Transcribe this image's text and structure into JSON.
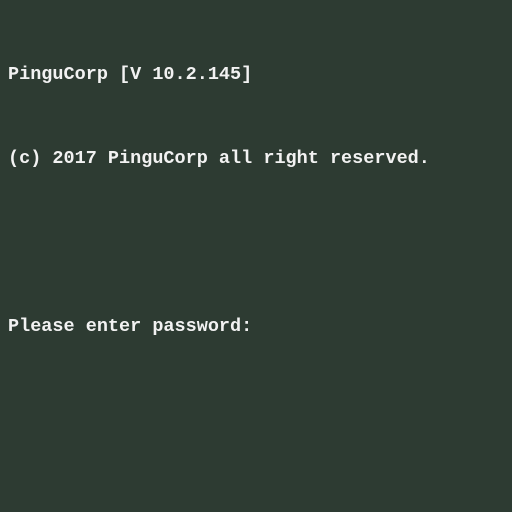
{
  "terminal": {
    "header_line": "PinguCorp [V 10.2.145]",
    "copyright_line": "(c) 2017 PinguCorp all right reserved.",
    "prompt_label": "Please enter password:",
    "password_value": "",
    "background_color": "#2d3b32",
    "text_color": "#f2f2f2"
  }
}
